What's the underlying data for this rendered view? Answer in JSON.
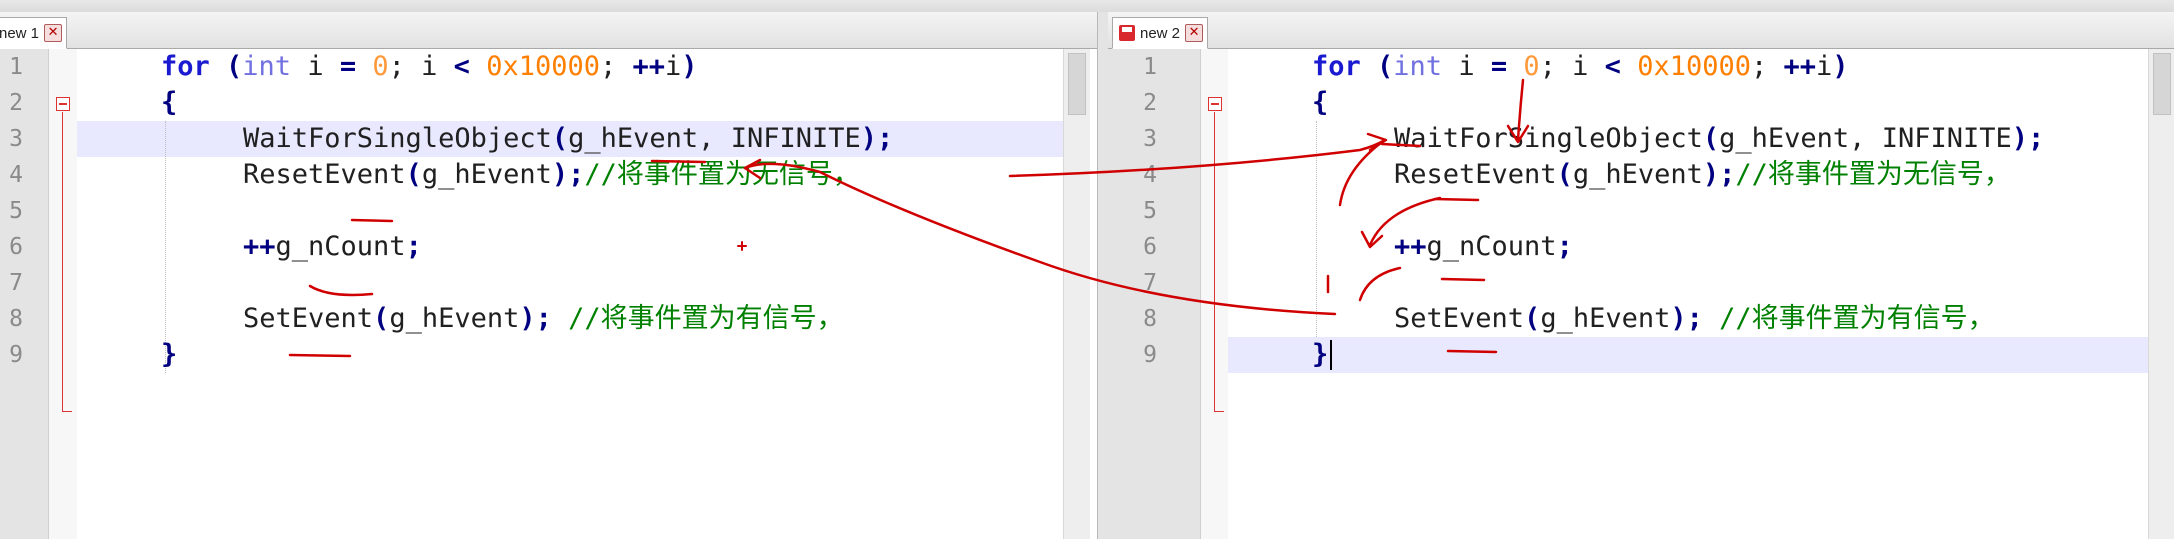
{
  "tabs": {
    "left": {
      "label": "new 1",
      "close": "✕"
    },
    "right": {
      "label": "new 2",
      "close": "✕"
    }
  },
  "line_numbers": [
    "1",
    "2",
    "3",
    "4",
    "5",
    "6",
    "7",
    "8",
    "9"
  ],
  "code": {
    "line1": {
      "for": "for",
      "lp": " (",
      "int": "int",
      "i": " i ",
      "eq": "=",
      "zero": " 0",
      "semi1": "; i ",
      "lt": "<",
      "hex": " 0x10000",
      "semi2": "; ",
      "inc": "++",
      "i2": "i",
      "rp": ")"
    },
    "line2": {
      "brace_open": "{"
    },
    "line3": {
      "fn": "WaitForSingleObject",
      "lp": "(",
      "arg1": "g_hEvent",
      "comma": ", ",
      "arg2": "INFINITE",
      "rp": ")",
      "semi": ";"
    },
    "line4": {
      "fn": "ResetEvent",
      "lp": "(",
      "arg": "g_hEvent",
      "rp": ")",
      "semi": ";",
      "comment": "//将事件置为无信号，"
    },
    "line6": {
      "inc": "++",
      "var": "g_nCount",
      "semi": ";"
    },
    "line8": {
      "fn": "SetEvent",
      "lp": "(",
      "arg": "g_hEvent",
      "rp": ")",
      "semi": "; ",
      "comment": "//将事件置为有信号，"
    },
    "line9": {
      "brace_close": "}"
    }
  },
  "colors": {
    "keyword": "#1a1ad0",
    "type": "#7070e0",
    "number": "#ff8000",
    "comment": "#008000",
    "operator": "#000080",
    "current_line": "#e8e8ff",
    "annotation_ink": "#d00000"
  },
  "icons": {
    "tab_close": "close-icon",
    "unsaved": "save-icon",
    "fold": "fold-minus-icon"
  }
}
